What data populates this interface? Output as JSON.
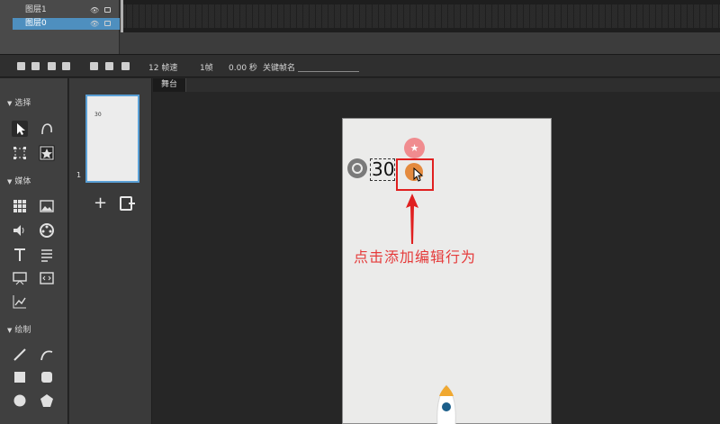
{
  "layers": [
    {
      "name": "图层1",
      "selected": false
    },
    {
      "name": "图层0",
      "selected": true
    }
  ],
  "toolbar": {
    "fps": "12 帧速",
    "frame": "1帧",
    "seconds": "0.00 秒",
    "keyframe_name_label": "关键帧名"
  },
  "tools_panel": {
    "select_label": "选择",
    "media_label": "媒体",
    "draw_label": "绘制"
  },
  "pages_panel": {
    "thumbnail_counter": "30",
    "page_number": "1",
    "add_icon": "plus-icon",
    "add_page_icon": "add-page-icon"
  },
  "stage": {
    "tab_label": "舞台",
    "counter_value": "30",
    "annotation_text": "点击添加编辑行为",
    "colors": {
      "highlight": "#e02020",
      "annotation": "#e53a3a",
      "pink_button": "#f08c8f",
      "orange_button": "#e48a3e",
      "thumb_border": "#5aa0d6"
    }
  }
}
